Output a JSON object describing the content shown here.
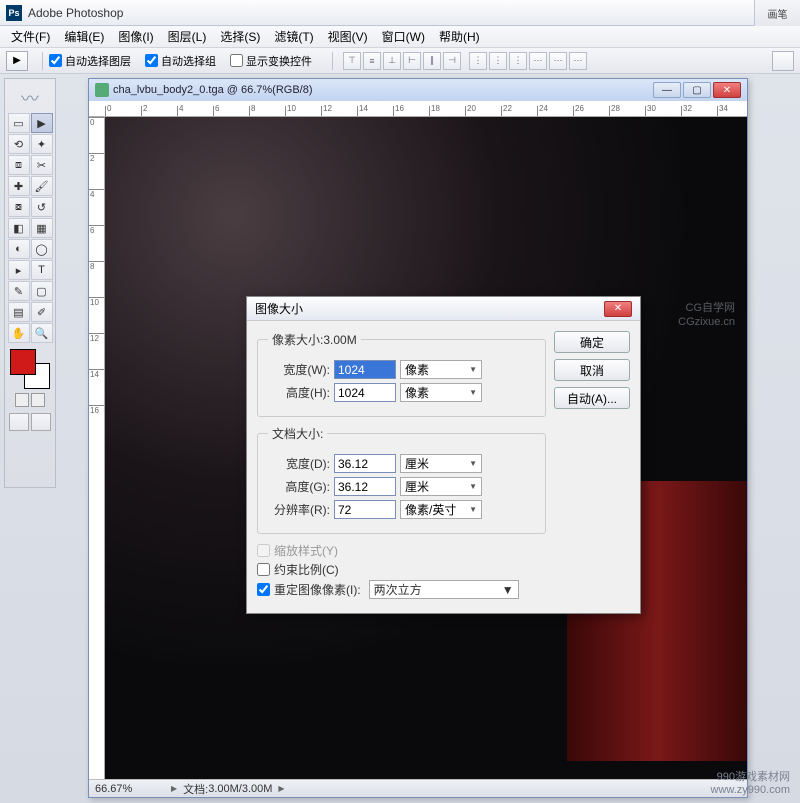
{
  "app": {
    "title": "Adobe Photoshop"
  },
  "menu": {
    "file": "文件(F)",
    "edit": "编辑(E)",
    "image": "图像(I)",
    "layer": "图层(L)",
    "select": "选择(S)",
    "filter": "滤镜(T)",
    "view": "视图(V)",
    "window": "窗口(W)",
    "help": "帮助(H)"
  },
  "options": {
    "auto_select_layer": "自动选择图层",
    "auto_select_group": "自动选择组",
    "show_transform": "显示变换控件"
  },
  "right_panel": {
    "brush": "画笔"
  },
  "document": {
    "title": "cha_lvbu_body2_0.tga @ 66.7%(RGB/8)",
    "zoom": "66.67%",
    "status_left": "文档:",
    "status_value": "3.00M/3.00M",
    "ruler_ticks": [
      "0",
      "2",
      "4",
      "6",
      "8",
      "10",
      "12",
      "14",
      "16",
      "18",
      "20",
      "22",
      "24",
      "26",
      "28",
      "30",
      "32",
      "34"
    ],
    "ruler_ticks_v": [
      "0",
      "2",
      "4",
      "6",
      "8",
      "10",
      "12",
      "14",
      "16"
    ]
  },
  "watermark": {
    "main": "www.zy990.com",
    "side_a": "CG自学网",
    "side_b": "CGzixue.cn"
  },
  "dialog": {
    "title": "图像大小",
    "pixel_legend": "像素大小:3.00M",
    "doc_legend": "文档大小:",
    "width_label": "宽度(W):",
    "height_label": "高度(H):",
    "width_d_label": "宽度(D):",
    "height_g_label": "高度(G):",
    "resolution_label": "分辨率(R):",
    "pixel_unit": "像素",
    "cm_unit": "厘米",
    "res_unit": "像素/英寸",
    "px_width": "1024",
    "px_height": "1024",
    "doc_width": "36.12",
    "doc_height": "36.12",
    "resolution": "72",
    "scale_styles": "缩放样式(Y)",
    "constrain": "约束比例(C)",
    "resample": "重定图像像素(I):",
    "resample_method": "两次立方",
    "ok": "确定",
    "cancel": "取消",
    "auto": "自动(A)..."
  },
  "footer": {
    "site_a": "990游戏素材网",
    "site_b": "www.zy990.com"
  },
  "colors": {
    "fg": "#d01919",
    "bg": "#ffffff"
  }
}
